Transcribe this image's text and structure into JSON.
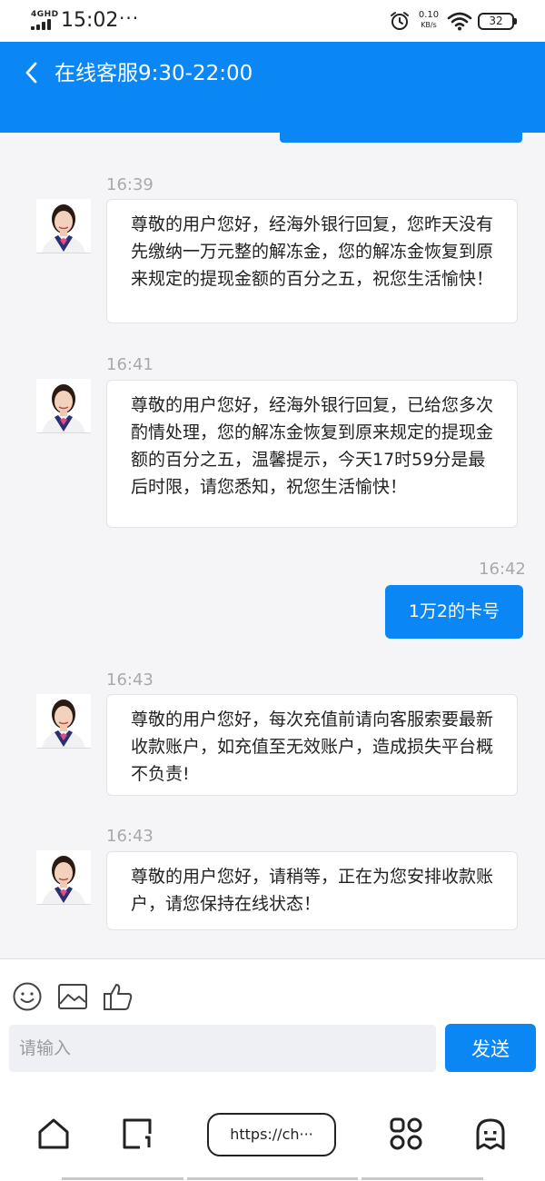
{
  "status_bar": {
    "network": "4GHD",
    "time": "15:02",
    "more": "···",
    "speed_value": "0.10",
    "speed_unit": "KB/s",
    "battery": "32"
  },
  "header": {
    "title": "在线客服9:30-22:00",
    "back_icon": "chevron-left-icon"
  },
  "messages": [
    {
      "side": "left",
      "time": "16:39",
      "text": "尊敬的用户您好，经海外银行回复，您昨天没有先缴纳一万元整的解冻金，您的解冻金恢复到原来规定的提现金额的百分之五，祝您生活愉快！"
    },
    {
      "side": "left",
      "time": "16:41",
      "text": "尊敬的用户您好，经海外银行回复，已给您多次酌情处理，您的解冻金恢复到原来规定的提现金额的百分之五，温馨提示，今天17时59分是最后时限，请您悉知，祝您生活愉快！"
    },
    {
      "side": "right",
      "time": "16:42",
      "text": "1万2的卡号"
    },
    {
      "side": "left",
      "time": "16:43",
      "text": "尊敬的用户您好，每次充值前请向客服索要最新收款账户，如充值至无效账户，造成损失平台概不负责!"
    },
    {
      "side": "left",
      "time": "16:43",
      "text": "尊敬的用户您好，请稍等，正在为您安排收款账户，请您保持在线状态！"
    }
  ],
  "toolbar": {
    "icons": [
      "emoji-icon",
      "image-icon",
      "thumbs-up-icon"
    ]
  },
  "composer": {
    "placeholder": "请输入",
    "value": "",
    "send_label": "发送"
  },
  "browser_nav": {
    "url": "https://ch···",
    "icons": [
      "home-icon",
      "tabs-icon",
      "apps-icon",
      "ghost-icon"
    ]
  },
  "colors": {
    "accent": "#0a87f5",
    "background": "#f5f5f7",
    "timestamp": "#a8a8ad"
  }
}
